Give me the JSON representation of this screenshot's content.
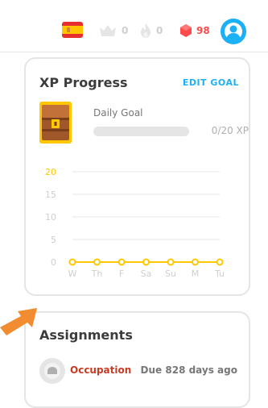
{
  "header": {
    "language": "Spanish",
    "crowns": "0",
    "streak": "0",
    "gems": "98"
  },
  "colors": {
    "accent_blue": "#1cb0f6",
    "gold": "#ffc800",
    "gem_red": "#ff4b4b",
    "assignment_red": "#c93a23",
    "arrow_orange": "#f28c30"
  },
  "xp": {
    "title": "XP Progress",
    "edit_goal": "EDIT GOAL",
    "daily_goal_label": "Daily Goal",
    "goal_value": "0/20 XP",
    "goal_progress": 0
  },
  "assignments": {
    "title": "Assignments",
    "items": [
      {
        "name": "Occupation",
        "due": "Due 828 days ago",
        "icon": "lesson-icon"
      }
    ]
  },
  "chart_data": {
    "type": "line",
    "categories": [
      "W",
      "Th",
      "F",
      "Sa",
      "Su",
      "M",
      "Tu"
    ],
    "series": [
      {
        "values": [
          0,
          0,
          0,
          0,
          0,
          0,
          0
        ]
      }
    ],
    "yticks": [
      0,
      5,
      10,
      15,
      20
    ],
    "ylim": [
      0,
      20
    ],
    "goal": 20,
    "grid": true
  }
}
